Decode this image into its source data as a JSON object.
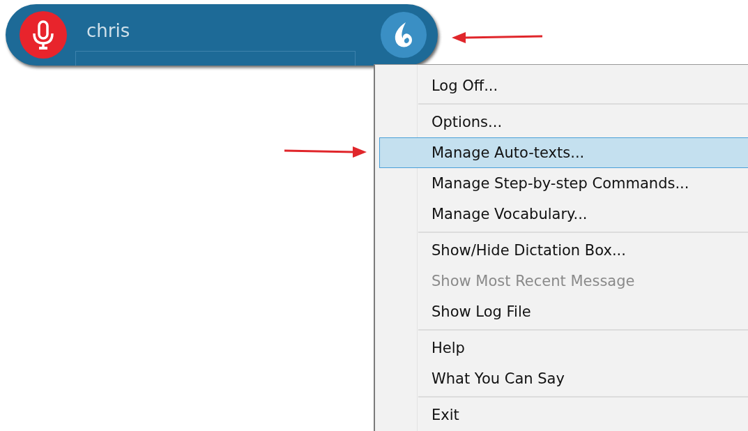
{
  "dictation_bar": {
    "user": "chris"
  },
  "menu": {
    "sections": [
      [
        {
          "label": "Log Off...",
          "selected": false,
          "disabled": false
        }
      ],
      [
        {
          "label": "Options...",
          "selected": false,
          "disabled": false
        },
        {
          "label": "Manage Auto-texts...",
          "selected": true,
          "disabled": false
        },
        {
          "label": "Manage Step-by-step Commands...",
          "selected": false,
          "disabled": false
        },
        {
          "label": "Manage Vocabulary...",
          "selected": false,
          "disabled": false
        }
      ],
      [
        {
          "label": "Show/Hide Dictation Box...",
          "selected": false,
          "disabled": false
        },
        {
          "label": "Show Most Recent Message",
          "selected": false,
          "disabled": true
        },
        {
          "label": "Show Log File",
          "selected": false,
          "disabled": false
        }
      ],
      [
        {
          "label": "Help",
          "selected": false,
          "disabled": false
        },
        {
          "label": "What You Can Say",
          "selected": false,
          "disabled": false
        }
      ],
      [
        {
          "label": "Exit",
          "selected": false,
          "disabled": false
        }
      ]
    ]
  }
}
